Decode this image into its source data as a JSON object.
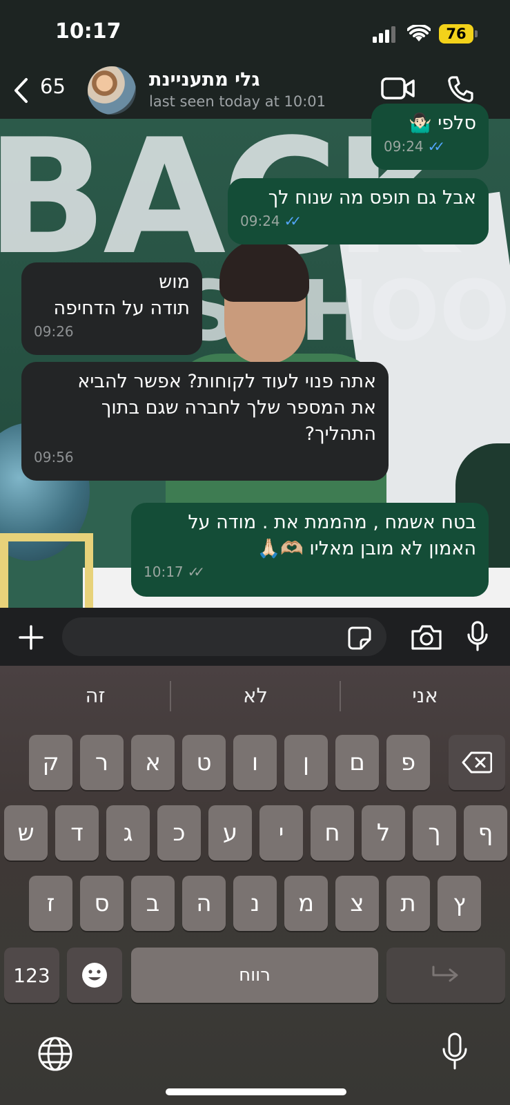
{
  "status_bar": {
    "time": "10:17",
    "battery": "76"
  },
  "header": {
    "back_count": "65",
    "contact_name": "גלי מתעניינת",
    "last_seen": "last seen today at 10:01"
  },
  "messages": [
    {
      "direction": "outgoing",
      "text": "סלפי 🤷🏻‍♂️",
      "time": "09:24",
      "status": "read"
    },
    {
      "direction": "outgoing",
      "text": "אבל גם תופס מה שנוח לך",
      "time": "09:24",
      "status": "read"
    },
    {
      "direction": "incoming",
      "text": "מוש\nתודה על הדחיפה",
      "time": "09:26"
    },
    {
      "direction": "incoming",
      "text": "אתה פנוי לעוד לקוחות? אפשר להביא\nאת המספר שלך לחברה שגם בתוך\nהתהליך?",
      "time": "09:56"
    },
    {
      "direction": "outgoing",
      "text": "בטח אשמח , מהממת את . מודה על\nהאמון לא מובן מאליו 🫶🏼🙏🏻",
      "time": "10:17",
      "status": "delivered"
    }
  ],
  "input": {
    "placeholder": ""
  },
  "keyboard": {
    "suggestions": [
      "זה",
      "לא",
      "אני"
    ],
    "row1": [
      "ק",
      "ר",
      "א",
      "ט",
      "ו",
      "ן",
      "ם",
      "פ"
    ],
    "row2": [
      "ש",
      "ד",
      "ג",
      "כ",
      "ע",
      "י",
      "ח",
      "ל",
      "ך",
      "ף"
    ],
    "row3": [
      "ז",
      "ס",
      "ב",
      "ה",
      "נ",
      "מ",
      "צ",
      "ת",
      "ץ"
    ],
    "numbers_label": "123",
    "space_label": "רווח"
  },
  "colors": {
    "outgoing_bubble": "#144d37",
    "incoming_bubble": "#232526",
    "read_ticks": "#53a6fd",
    "battery": "#f3d21a"
  },
  "icons": [
    "back-chevron-icon",
    "video-call-icon",
    "phone-icon",
    "plus-icon",
    "sticker-icon",
    "camera-icon",
    "mic-icon",
    "backspace-icon",
    "emoji-icon",
    "return-icon",
    "globe-icon",
    "dictation-mic-icon"
  ]
}
